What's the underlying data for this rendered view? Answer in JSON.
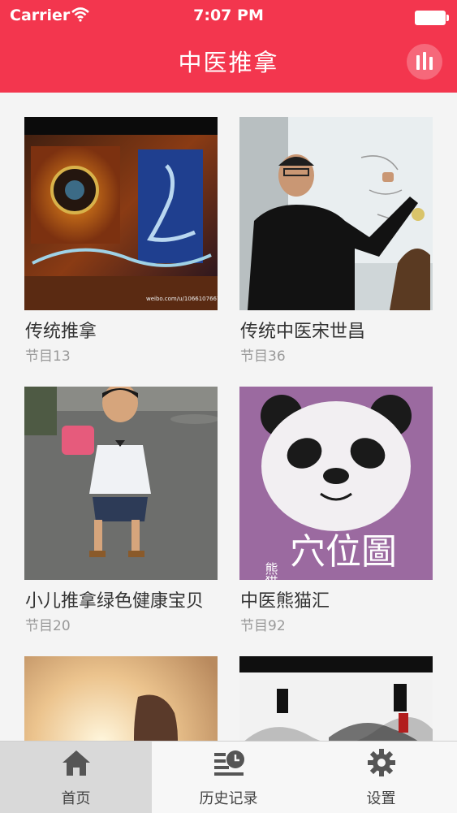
{
  "status_bar": {
    "carrier": "Carrier",
    "time": "7:07 PM"
  },
  "header": {
    "title": "中医推拿"
  },
  "grid": {
    "items": [
      {
        "title": "传统推拿",
        "subtitle": "节目13",
        "watermark": "weibo.com/u/1066107667"
      },
      {
        "title": "传统中医宋世昌",
        "subtitle": "节目36"
      },
      {
        "title": "小儿推拿绿色健康宝贝",
        "subtitle": "节目20"
      },
      {
        "title": "中医熊猫汇",
        "subtitle": "节目92",
        "art_text": [
          "熊猫",
          "穴位圖"
        ]
      },
      {
        "title": "",
        "subtitle": ""
      },
      {
        "title": "",
        "subtitle": ""
      }
    ]
  },
  "tabbar": {
    "tabs": [
      {
        "label": "首页",
        "icon": "home-icon"
      },
      {
        "label": "历史记录",
        "icon": "history-icon"
      },
      {
        "label": "设置",
        "icon": "gear-icon"
      }
    ]
  },
  "colors": {
    "accent": "#f3364e"
  }
}
